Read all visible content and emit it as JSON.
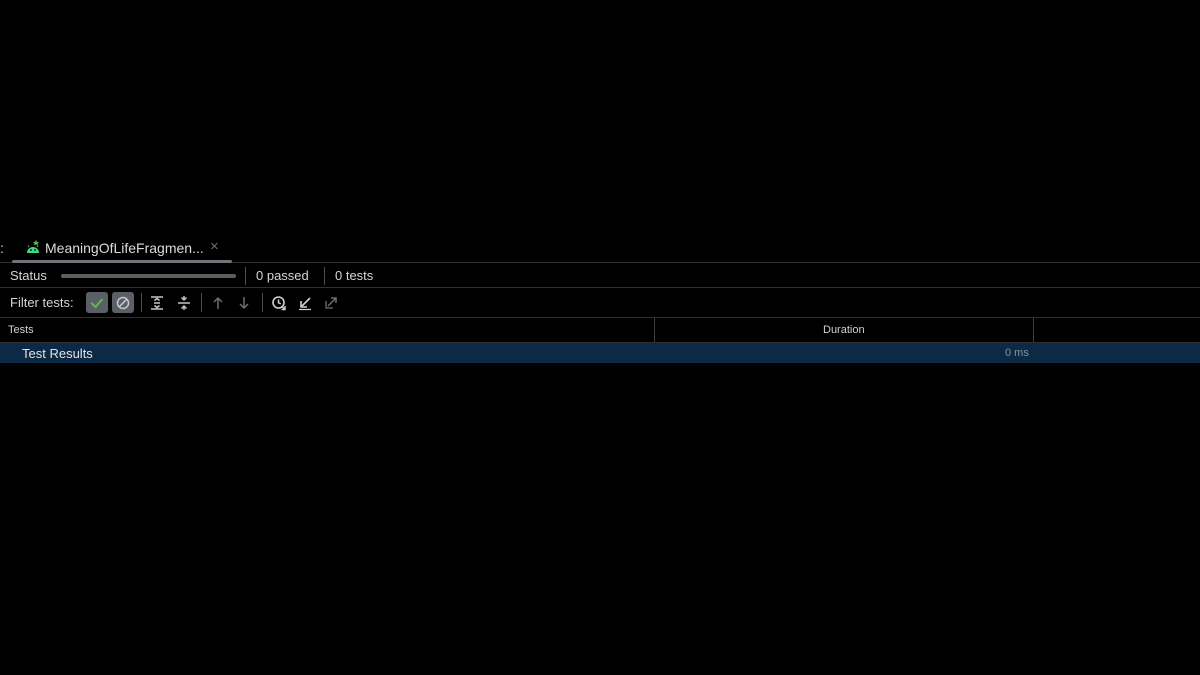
{
  "tab": {
    "prefix": ":",
    "title": "MeaningOfLifeFragmen...",
    "close_symbol": "×",
    "icon": "android-test-run-icon"
  },
  "status": {
    "label": "Status",
    "progress": 0,
    "passed": "0 passed",
    "tests": "0 tests"
  },
  "filter": {
    "label": "Filter tests:",
    "buttons": [
      {
        "name": "show-passed-toggle",
        "icon": "check-icon",
        "active": true
      },
      {
        "name": "show-ignored-toggle",
        "icon": "ignored-icon",
        "active": true
      },
      {
        "name": "expand-all-button",
        "icon": "expand-all-icon"
      },
      {
        "name": "collapse-all-button",
        "icon": "collapse-all-icon"
      },
      {
        "name": "previous-failed-button",
        "icon": "arrow-up-icon"
      },
      {
        "name": "next-failed-button",
        "icon": "arrow-down-icon"
      },
      {
        "name": "test-history-button",
        "icon": "history-icon"
      },
      {
        "name": "import-tests-button",
        "icon": "import-icon"
      },
      {
        "name": "export-tests-button",
        "icon": "export-icon"
      }
    ]
  },
  "table": {
    "columns": [
      "Tests",
      "Duration"
    ],
    "rows": [
      {
        "name": "Test Results",
        "duration": "0 ms"
      }
    ]
  },
  "colors": {
    "background": "#000000",
    "selected_row": "#0c2a45",
    "check_green": "#5fb85a",
    "android_green": "#3ddc84"
  }
}
